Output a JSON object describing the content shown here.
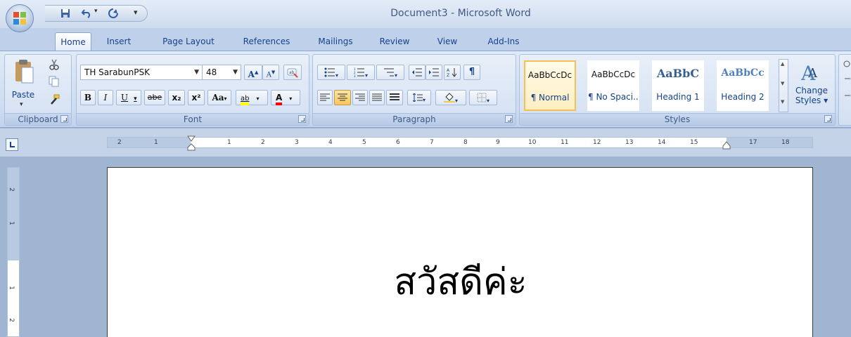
{
  "window": {
    "title": "Document3 - Microsoft Word"
  },
  "qat": {
    "save_icon": "save-icon",
    "undo_icon": "undo-icon",
    "redo_icon": "redo-icon",
    "customize": "▾"
  },
  "tabs": [
    {
      "label": "Home",
      "active": true
    },
    {
      "label": "Insert"
    },
    {
      "label": "Page Layout"
    },
    {
      "label": "References"
    },
    {
      "label": "Mailings"
    },
    {
      "label": "Review"
    },
    {
      "label": "View"
    },
    {
      "label": "Add-Ins"
    }
  ],
  "clipboard": {
    "label": "Clipboard",
    "paste": "Paste"
  },
  "font": {
    "label": "Font",
    "name": "TH SarabunPSK",
    "size": "48",
    "grow": "A",
    "shrink": "A",
    "bold": "B",
    "italic": "I",
    "underline": "U",
    "strike": "abe",
    "sub": "x₂",
    "sup": "x²",
    "case": "Aa",
    "highlight": "ab",
    "color": "A"
  },
  "paragraph": {
    "label": "Paragraph",
    "pilcrow": "¶"
  },
  "styles": {
    "label": "Styles",
    "items": [
      {
        "preview": "AaBbCcDc",
        "name": "¶ Normal",
        "selected": true
      },
      {
        "preview": "AaBbCcDc",
        "name": "¶ No Spaci..."
      },
      {
        "preview": "AaBbC",
        "name": "Heading 1"
      },
      {
        "preview": "AaBbCc",
        "name": "Heading 2"
      }
    ],
    "change_styles": "Change Styles ▾"
  },
  "ruler": {
    "numbers": [
      "2",
      "1",
      "1",
      "2",
      "3",
      "4",
      "5",
      "6",
      "7",
      "8",
      "9",
      "10",
      "11",
      "12",
      "13",
      "14",
      "15",
      "17",
      "18"
    ],
    "vertical": [
      "2",
      "1",
      "1",
      "2"
    ]
  },
  "document": {
    "text": "สวัสดีค่ะ"
  },
  "colors": {
    "highlight": "#ffff00",
    "font_color": "#ff0000",
    "accent": "#f5c155"
  }
}
